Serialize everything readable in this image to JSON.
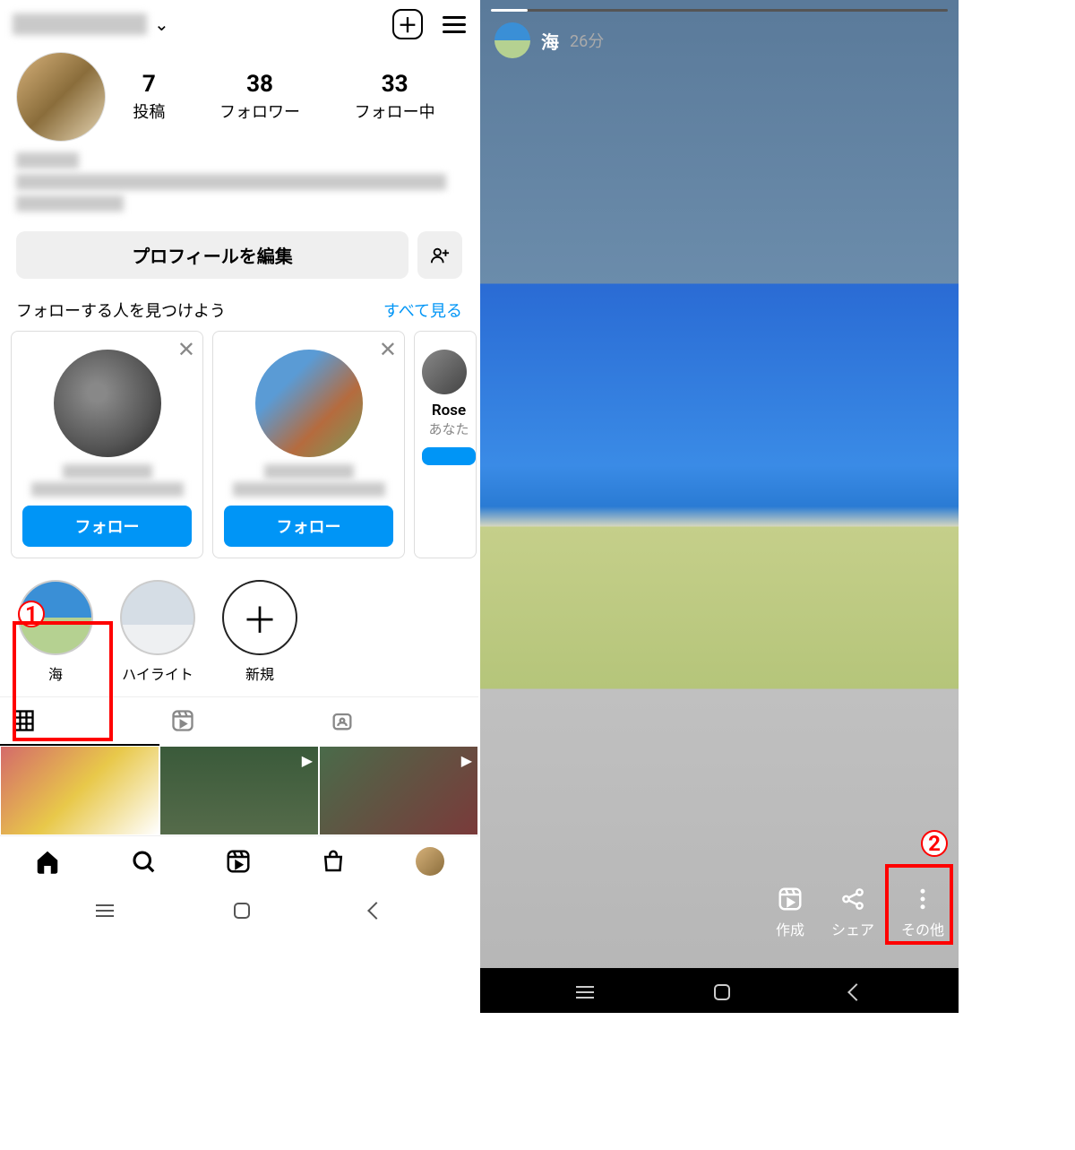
{
  "left": {
    "header": {
      "chevron": "⌄"
    },
    "stats": {
      "posts": {
        "num": "7",
        "label": "投稿"
      },
      "followers": {
        "num": "38",
        "label": "フォロワー"
      },
      "following": {
        "num": "33",
        "label": "フォロー中"
      }
    },
    "edit_profile": "プロフィールを編集",
    "discover": {
      "title": "フォローする人を見つけよう",
      "see_all": "すべて見る"
    },
    "suggestions": {
      "follow_btn": "フォロー",
      "card3": {
        "name": "Rose",
        "sub": "あなた"
      }
    },
    "highlights": {
      "sea": "海",
      "highlight": "ハイライト",
      "new": "新規",
      "plus": "＋"
    },
    "annotations": {
      "one": "1"
    }
  },
  "right": {
    "story": {
      "title": "海",
      "time": "26分"
    },
    "actions": {
      "create": "作成",
      "share": "シェア",
      "more": "その他"
    },
    "annotations": {
      "two": "2"
    }
  }
}
